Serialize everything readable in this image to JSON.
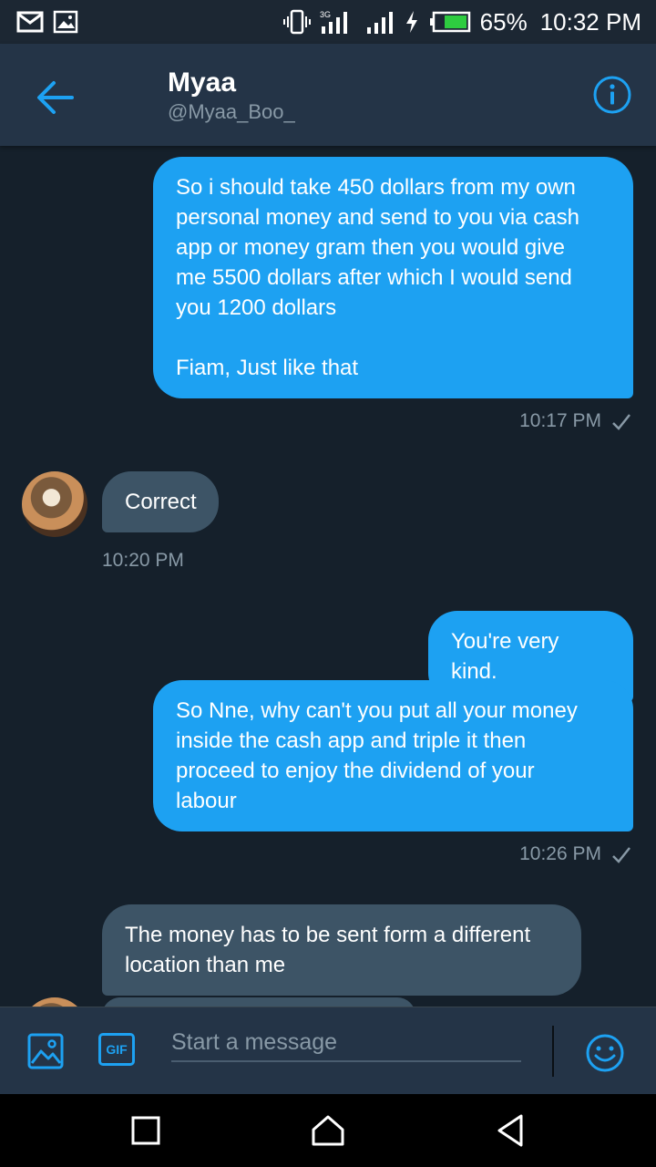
{
  "status_bar": {
    "battery_percent": "65%",
    "time": "10:32 PM",
    "icons": [
      "gmail-icon",
      "image-icon",
      "vibrate-icon",
      "signal-icon",
      "signal-icon",
      "charging-icon",
      "battery-icon"
    ]
  },
  "header": {
    "name": "Myaa",
    "handle": "@Myaa_Boo_",
    "back_icon": "back-arrow-icon",
    "info_icon": "info-icon"
  },
  "messages": [
    {
      "direction": "out",
      "text": "So i should take 450 dollars from my own\npersonal money and send to you via cash\napp or money gram then you would give\nme 5500 dollars after which I would send\nyou 1200 dollars\n\nFiam, Just like that",
      "time": "10:17 PM"
    },
    {
      "direction": "in",
      "text": "Correct",
      "time": "10:20 PM"
    },
    {
      "direction": "out",
      "text": "You're very kind."
    },
    {
      "direction": "out",
      "text": "So Nne, why can't you put all your money\ninside the cash app and triple it then\nproceed to enjoy the dividend of your\nlabour",
      "time": "10:26 PM"
    },
    {
      "direction": "in",
      "text": "The money has to be sent form a different\nlocation than me"
    }
  ],
  "composer": {
    "placeholder": "Start a message",
    "gif_label": "GIF",
    "icons": [
      "image-icon",
      "gif-icon",
      "emoji-icon"
    ]
  },
  "colors": {
    "background": "#15202b",
    "header": "#243447",
    "outgoing_bubble": "#1da1f2",
    "incoming_bubble": "#3d5466",
    "accent": "#1da1f2",
    "secondary_text": "#8899a6"
  }
}
